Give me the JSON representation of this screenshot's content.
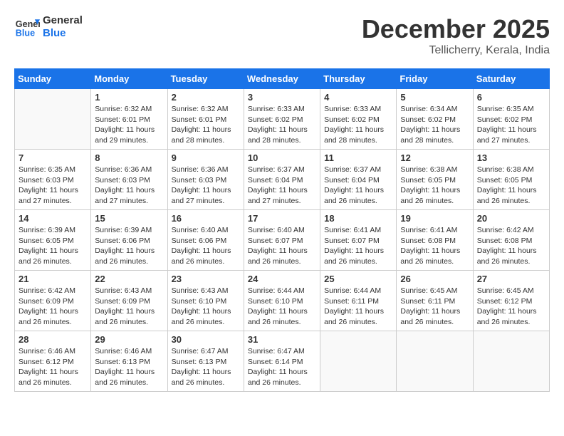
{
  "logo": {
    "line1": "General",
    "line2": "Blue"
  },
  "title": {
    "month": "December 2025",
    "location": "Tellicherry, Kerala, India"
  },
  "calendar": {
    "headers": [
      "Sunday",
      "Monday",
      "Tuesday",
      "Wednesday",
      "Thursday",
      "Friday",
      "Saturday"
    ],
    "weeks": [
      [
        {
          "day": "",
          "sunrise": "",
          "sunset": "",
          "daylight": ""
        },
        {
          "day": "1",
          "sunrise": "Sunrise: 6:32 AM",
          "sunset": "Sunset: 6:01 PM",
          "daylight": "Daylight: 11 hours and 29 minutes."
        },
        {
          "day": "2",
          "sunrise": "Sunrise: 6:32 AM",
          "sunset": "Sunset: 6:01 PM",
          "daylight": "Daylight: 11 hours and 28 minutes."
        },
        {
          "day": "3",
          "sunrise": "Sunrise: 6:33 AM",
          "sunset": "Sunset: 6:02 PM",
          "daylight": "Daylight: 11 hours and 28 minutes."
        },
        {
          "day": "4",
          "sunrise": "Sunrise: 6:33 AM",
          "sunset": "Sunset: 6:02 PM",
          "daylight": "Daylight: 11 hours and 28 minutes."
        },
        {
          "day": "5",
          "sunrise": "Sunrise: 6:34 AM",
          "sunset": "Sunset: 6:02 PM",
          "daylight": "Daylight: 11 hours and 28 minutes."
        },
        {
          "day": "6",
          "sunrise": "Sunrise: 6:35 AM",
          "sunset": "Sunset: 6:02 PM",
          "daylight": "Daylight: 11 hours and 27 minutes."
        }
      ],
      [
        {
          "day": "7",
          "sunrise": "Sunrise: 6:35 AM",
          "sunset": "Sunset: 6:03 PM",
          "daylight": "Daylight: 11 hours and 27 minutes."
        },
        {
          "day": "8",
          "sunrise": "Sunrise: 6:36 AM",
          "sunset": "Sunset: 6:03 PM",
          "daylight": "Daylight: 11 hours and 27 minutes."
        },
        {
          "day": "9",
          "sunrise": "Sunrise: 6:36 AM",
          "sunset": "Sunset: 6:03 PM",
          "daylight": "Daylight: 11 hours and 27 minutes."
        },
        {
          "day": "10",
          "sunrise": "Sunrise: 6:37 AM",
          "sunset": "Sunset: 6:04 PM",
          "daylight": "Daylight: 11 hours and 27 minutes."
        },
        {
          "day": "11",
          "sunrise": "Sunrise: 6:37 AM",
          "sunset": "Sunset: 6:04 PM",
          "daylight": "Daylight: 11 hours and 26 minutes."
        },
        {
          "day": "12",
          "sunrise": "Sunrise: 6:38 AM",
          "sunset": "Sunset: 6:05 PM",
          "daylight": "Daylight: 11 hours and 26 minutes."
        },
        {
          "day": "13",
          "sunrise": "Sunrise: 6:38 AM",
          "sunset": "Sunset: 6:05 PM",
          "daylight": "Daylight: 11 hours and 26 minutes."
        }
      ],
      [
        {
          "day": "14",
          "sunrise": "Sunrise: 6:39 AM",
          "sunset": "Sunset: 6:05 PM",
          "daylight": "Daylight: 11 hours and 26 minutes."
        },
        {
          "day": "15",
          "sunrise": "Sunrise: 6:39 AM",
          "sunset": "Sunset: 6:06 PM",
          "daylight": "Daylight: 11 hours and 26 minutes."
        },
        {
          "day": "16",
          "sunrise": "Sunrise: 6:40 AM",
          "sunset": "Sunset: 6:06 PM",
          "daylight": "Daylight: 11 hours and 26 minutes."
        },
        {
          "day": "17",
          "sunrise": "Sunrise: 6:40 AM",
          "sunset": "Sunset: 6:07 PM",
          "daylight": "Daylight: 11 hours and 26 minutes."
        },
        {
          "day": "18",
          "sunrise": "Sunrise: 6:41 AM",
          "sunset": "Sunset: 6:07 PM",
          "daylight": "Daylight: 11 hours and 26 minutes."
        },
        {
          "day": "19",
          "sunrise": "Sunrise: 6:41 AM",
          "sunset": "Sunset: 6:08 PM",
          "daylight": "Daylight: 11 hours and 26 minutes."
        },
        {
          "day": "20",
          "sunrise": "Sunrise: 6:42 AM",
          "sunset": "Sunset: 6:08 PM",
          "daylight": "Daylight: 11 hours and 26 minutes."
        }
      ],
      [
        {
          "day": "21",
          "sunrise": "Sunrise: 6:42 AM",
          "sunset": "Sunset: 6:09 PM",
          "daylight": "Daylight: 11 hours and 26 minutes."
        },
        {
          "day": "22",
          "sunrise": "Sunrise: 6:43 AM",
          "sunset": "Sunset: 6:09 PM",
          "daylight": "Daylight: 11 hours and 26 minutes."
        },
        {
          "day": "23",
          "sunrise": "Sunrise: 6:43 AM",
          "sunset": "Sunset: 6:10 PM",
          "daylight": "Daylight: 11 hours and 26 minutes."
        },
        {
          "day": "24",
          "sunrise": "Sunrise: 6:44 AM",
          "sunset": "Sunset: 6:10 PM",
          "daylight": "Daylight: 11 hours and 26 minutes."
        },
        {
          "day": "25",
          "sunrise": "Sunrise: 6:44 AM",
          "sunset": "Sunset: 6:11 PM",
          "daylight": "Daylight: 11 hours and 26 minutes."
        },
        {
          "day": "26",
          "sunrise": "Sunrise: 6:45 AM",
          "sunset": "Sunset: 6:11 PM",
          "daylight": "Daylight: 11 hours and 26 minutes."
        },
        {
          "day": "27",
          "sunrise": "Sunrise: 6:45 AM",
          "sunset": "Sunset: 6:12 PM",
          "daylight": "Daylight: 11 hours and 26 minutes."
        }
      ],
      [
        {
          "day": "28",
          "sunrise": "Sunrise: 6:46 AM",
          "sunset": "Sunset: 6:12 PM",
          "daylight": "Daylight: 11 hours and 26 minutes."
        },
        {
          "day": "29",
          "sunrise": "Sunrise: 6:46 AM",
          "sunset": "Sunset: 6:13 PM",
          "daylight": "Daylight: 11 hours and 26 minutes."
        },
        {
          "day": "30",
          "sunrise": "Sunrise: 6:47 AM",
          "sunset": "Sunset: 6:13 PM",
          "daylight": "Daylight: 11 hours and 26 minutes."
        },
        {
          "day": "31",
          "sunrise": "Sunrise: 6:47 AM",
          "sunset": "Sunset: 6:14 PM",
          "daylight": "Daylight: 11 hours and 26 minutes."
        },
        {
          "day": "",
          "sunrise": "",
          "sunset": "",
          "daylight": ""
        },
        {
          "day": "",
          "sunrise": "",
          "sunset": "",
          "daylight": ""
        },
        {
          "day": "",
          "sunrise": "",
          "sunset": "",
          "daylight": ""
        }
      ]
    ]
  }
}
